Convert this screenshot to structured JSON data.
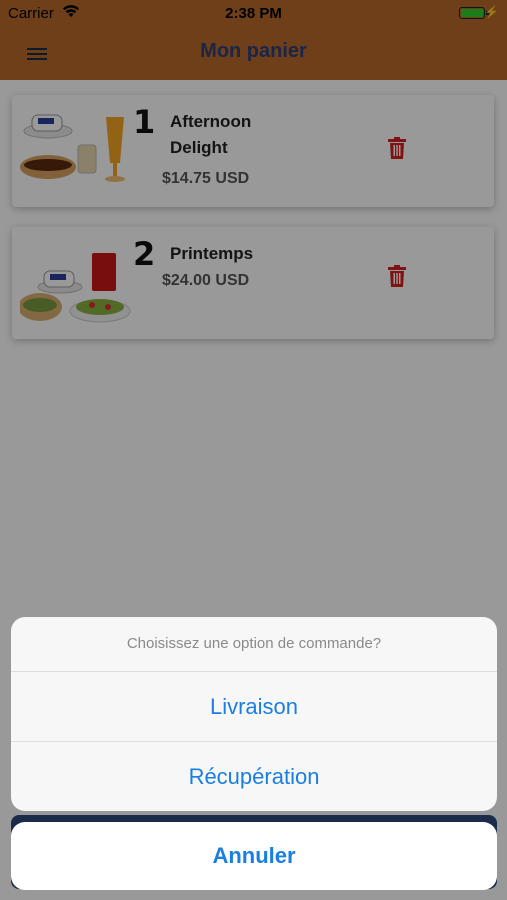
{
  "status_bar": {
    "carrier": "Carrier",
    "time": "2:38 PM",
    "battery_color": "#2dd32d"
  },
  "header": {
    "title": "Mon panier",
    "menu_icon": "hamburger-icon",
    "background_color": "#b86a2a",
    "title_color": "#2a3f7a"
  },
  "cart": {
    "items": [
      {
        "quantity": "1",
        "name_line1": "Afternoon",
        "name_line2": "Delight",
        "price": "$14.75 USD",
        "image": "coffee-sandwich-juice-photo",
        "delete_icon": "trash-icon"
      },
      {
        "quantity": "2",
        "name_line1": "Printemps",
        "name_line2": "",
        "price": "$24.00 USD",
        "image": "coffee-sandwich-salad-photo",
        "delete_icon": "trash-icon"
      }
    ]
  },
  "action_sheet": {
    "title": "Choisissez une option de commande?",
    "options": [
      "Livraison",
      "Récupération"
    ],
    "cancel": "Annuler",
    "accent_color": "#1a7fe0"
  }
}
